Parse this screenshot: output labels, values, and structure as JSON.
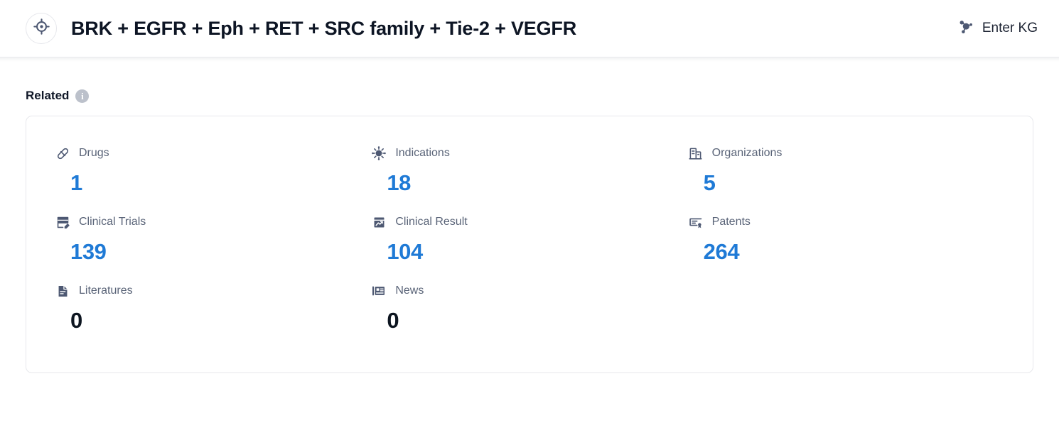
{
  "header": {
    "target_icon": "crosshair-target-icon",
    "title": "BRK + EGFR + Eph + RET + SRC family + Tie-2 + VEGFR",
    "kg_icon": "knowledge-graph-icon",
    "kg_label": "Enter KG"
  },
  "related": {
    "section_title": "Related",
    "info_icon": "info-icon",
    "accent_color": "#1f7ad6",
    "zero_color": "#0d1520",
    "label_color": "#5a6478",
    "icon_color": "#4d5872",
    "items": [
      {
        "icon": "pill-icon",
        "label": "Drugs",
        "value": "1",
        "zero": false
      },
      {
        "icon": "virus-icon",
        "label": "Indications",
        "value": "18",
        "zero": false
      },
      {
        "icon": "organization-icon",
        "label": "Organizations",
        "value": "5",
        "zero": false
      },
      {
        "icon": "clinical-trial-icon",
        "label": "Clinical Trials",
        "value": "139",
        "zero": false
      },
      {
        "icon": "clinical-result-icon",
        "label": "Clinical Result",
        "value": "104",
        "zero": false
      },
      {
        "icon": "patent-icon",
        "label": "Patents",
        "value": "264",
        "zero": false
      },
      {
        "icon": "literature-icon",
        "label": "Literatures",
        "value": "0",
        "zero": true
      },
      {
        "icon": "news-icon",
        "label": "News",
        "value": "0",
        "zero": true
      }
    ]
  }
}
